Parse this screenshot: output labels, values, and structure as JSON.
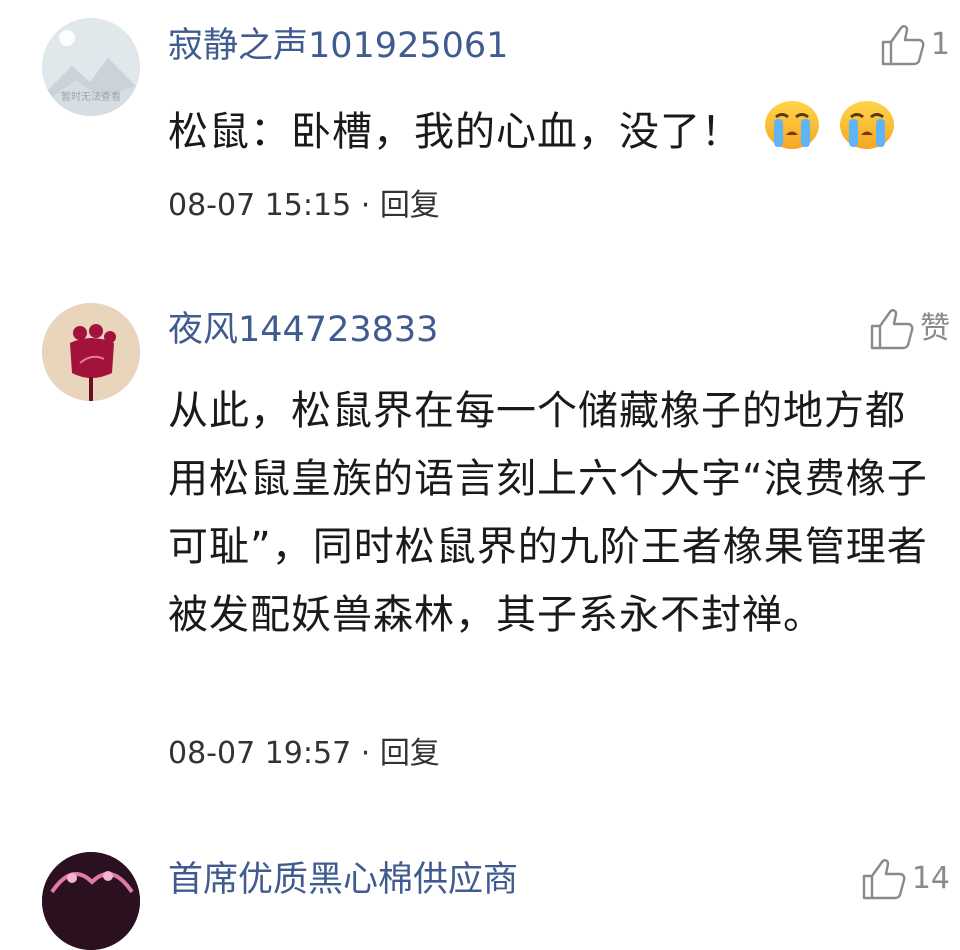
{
  "comments": [
    {
      "username": "寂静之声101925061",
      "likes": "1",
      "text": "松鼠：卧槽，我的心血，没了！",
      "emojis": [
        "crying-emoji",
        "crying-emoji"
      ],
      "avatar_caption": "暂时无法查看",
      "timestamp": "08-07 15:15",
      "separator": "·",
      "reply_label": "回复"
    },
    {
      "username": "夜风144723833",
      "likes": "赞",
      "text": "从此，松鼠界在每一个储藏橡子的地方都用松鼠皇族的语言刻上六个大字“浪费橡子可耻”，同时松鼠界的九阶王者橡果管理者被发配妖兽森林，其子系永不封禅。",
      "timestamp": "08-07 19:57",
      "separator": "·",
      "reply_label": "回复"
    },
    {
      "username": "首席优质黑心棉供应商",
      "likes": "14"
    }
  ],
  "icons": {
    "like": "thumbs-up-icon"
  }
}
